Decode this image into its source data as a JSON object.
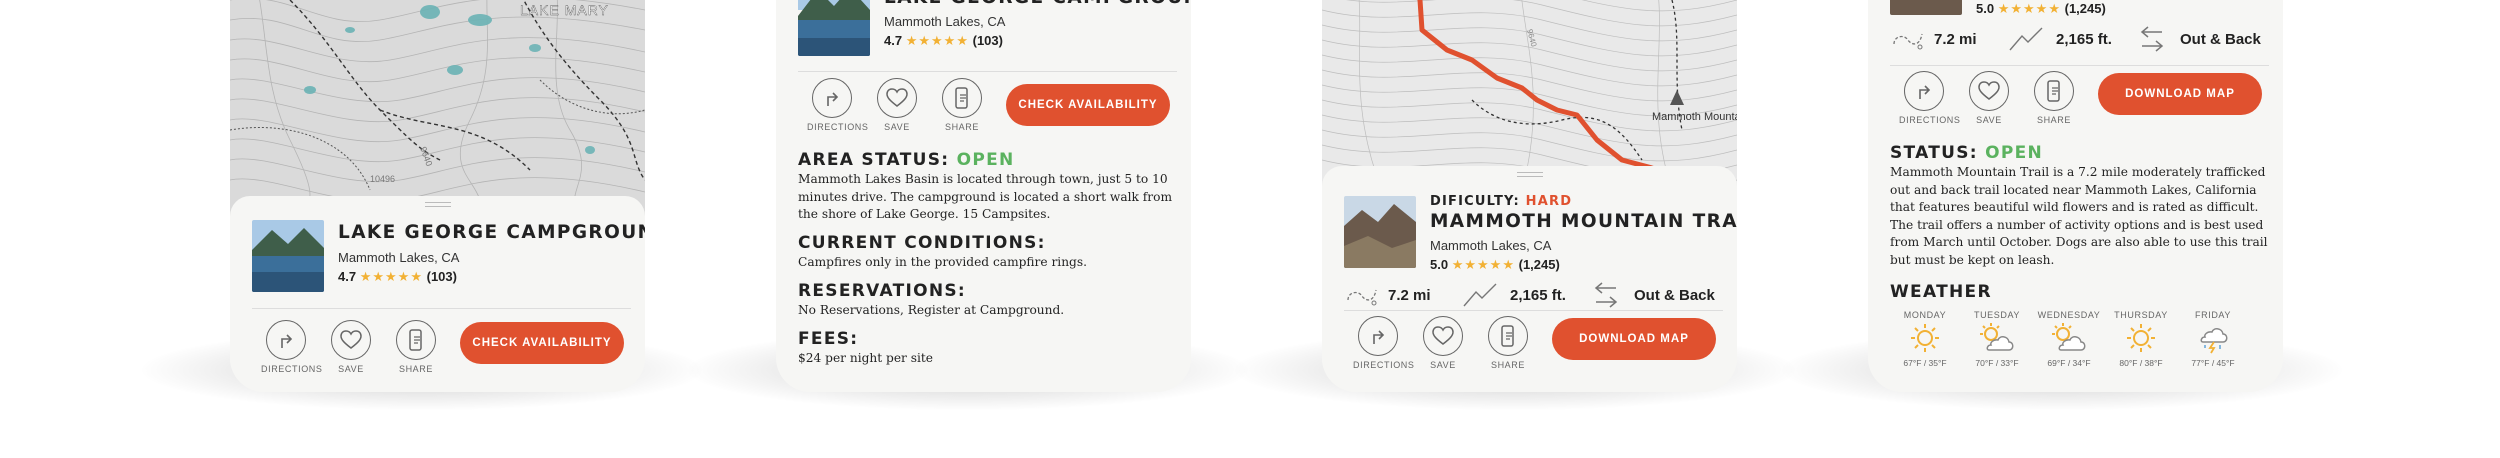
{
  "colors": {
    "accent": "#e0512f",
    "open": "#5bb25f",
    "hard": "#e0512f",
    "star": "#f2b134"
  },
  "actions": {
    "directions": "DIRECTIONS",
    "save": "SAVE",
    "share": "SHARE"
  },
  "screen1": {
    "map_label": "LAKE MARY",
    "contour_labels": [
      "9640",
      "10496"
    ],
    "title": "LAKE GEORGE CAMPGROUND",
    "location": "Mammoth Lakes, CA",
    "rating": "4.7",
    "stars": "★★★★★",
    "reviews": "(103)",
    "cta": "CHECK AVAILABILITY"
  },
  "screen2": {
    "title": "LAKE GEORGE CAMPGROUND",
    "location": "Mammoth Lakes, CA",
    "rating": "4.7",
    "stars": "★★★★★",
    "reviews": "(103)",
    "cta": "CHECK AVAILABILITY",
    "area_status_label": "AREA STATUS:",
    "area_status_value": "OPEN",
    "area_status_text": "Mammoth Lakes Basin is located through town, just 5 to 10 minutes drive. The campground is located a short walk from the shore of Lake George. 15 Campsites.",
    "conditions_label": "CURRENT CONDITIONS:",
    "conditions_text": "Campfires only in the provided campfire rings.",
    "reservations_label": "RESERVATIONS:",
    "reservations_text": "No Reservations, Register at Campground.",
    "fees_label": "FEES:",
    "fees_text": "$24 per night per site"
  },
  "screen3": {
    "map_label": "Mammoth Mountain",
    "contour_label": "9640",
    "difficulty_label": "DIFICULTY:",
    "difficulty_value": "HARD",
    "title": "MAMMOTH MOUNTAIN TRAIL",
    "location": "Mammoth Lakes, CA",
    "rating": "5.0",
    "stars": "★★★★★",
    "reviews": "(1,245)",
    "distance": "7.2 mi",
    "elevation": "2,165 ft.",
    "route": "Out & Back",
    "cta": "DOWNLOAD MAP"
  },
  "screen4": {
    "rating": "5.0",
    "stars": "★★★★★",
    "reviews": "(1,245)",
    "distance": "7.2 mi",
    "elevation": "2,165 ft.",
    "route": "Out & Back",
    "cta": "DOWNLOAD MAP",
    "status_label": "STATUS:",
    "status_value": "OPEN",
    "status_text": "Mammoth Mountain Trail is a 7.2 mile moderately trafficked out and back trail located near Mammoth Lakes, California that features beautiful wild flowers and is rated as difficult. The trail offers a number of activity options and is best used from March until October. Dogs are also able to use this trail but must be kept on leash.",
    "weather_label": "WEATHER",
    "forecast": [
      {
        "day": "MONDAY",
        "temps": "67°F / 35°F",
        "icon": "sun-icon"
      },
      {
        "day": "TUESDAY",
        "temps": "70°F / 33°F",
        "icon": "partly-cloudy-icon"
      },
      {
        "day": "WEDNESDAY",
        "temps": "69°F / 34°F",
        "icon": "partly-cloudy-icon"
      },
      {
        "day": "THURSDAY",
        "temps": "80°F / 38°F",
        "icon": "sun-icon"
      },
      {
        "day": "FRIDAY",
        "temps": "77°F / 45°F",
        "icon": "thunderstorm-icon"
      }
    ]
  }
}
